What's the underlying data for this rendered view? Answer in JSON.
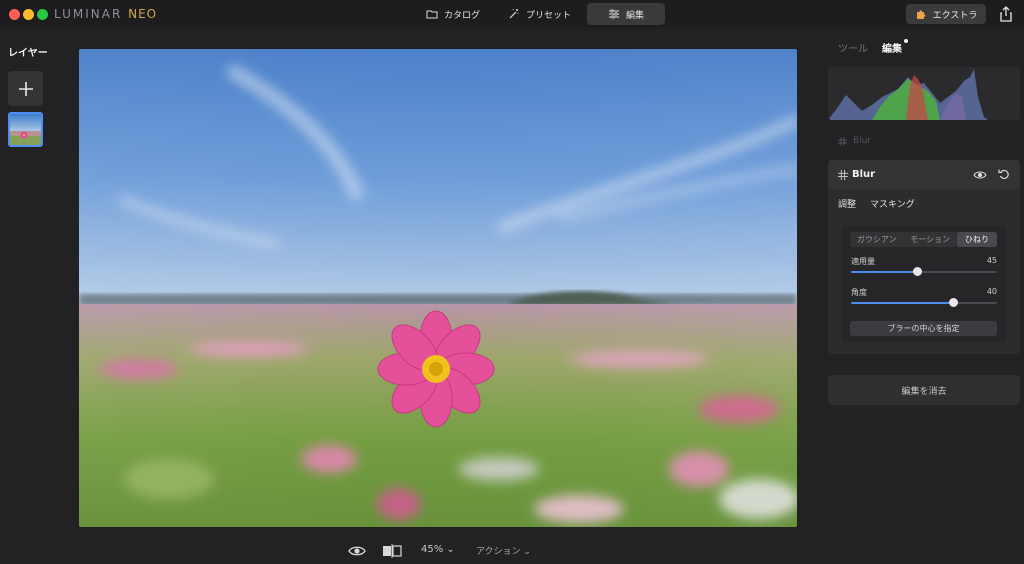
{
  "app": {
    "logo_main": "LUMINAR",
    "logo_accent": "NEO"
  },
  "topnav": [
    {
      "label": "カタログ",
      "icon": "folder-icon",
      "active": false
    },
    {
      "label": "プリセット",
      "icon": "magic-wand-icon",
      "active": false
    },
    {
      "label": "編集",
      "icon": "sliders-icon",
      "active": true
    }
  ],
  "extra": {
    "label": "エクストラ",
    "icon": "puzzle-icon"
  },
  "layers": {
    "title": "レイヤー"
  },
  "right_panel": {
    "tabs": [
      {
        "label": "ツール",
        "active": false
      },
      {
        "label": "編集",
        "active": true
      }
    ],
    "ghost_tool": "Blur",
    "tool": {
      "title": "Blur",
      "subtabs": [
        "調整",
        "マスキング"
      ],
      "modes": [
        {
          "label": "ガウシアン",
          "active": false
        },
        {
          "label": "モーション",
          "active": false
        },
        {
          "label": "ひねり",
          "active": true
        }
      ],
      "sliders": [
        {
          "label": "適用量",
          "value": "45",
          "fraction": 0.45
        },
        {
          "label": "角度",
          "value": "40",
          "fraction": 0.7
        }
      ],
      "center_button": "ブラーの中心を指定"
    },
    "clear_button": "編集を消去"
  },
  "bottom": {
    "zoom": "45% ⌄",
    "action": "アクション ⌄"
  },
  "colors": {
    "accent": "#4d8cf0",
    "logo_accent": "#d1a84b",
    "selection": "#4f8df5"
  }
}
